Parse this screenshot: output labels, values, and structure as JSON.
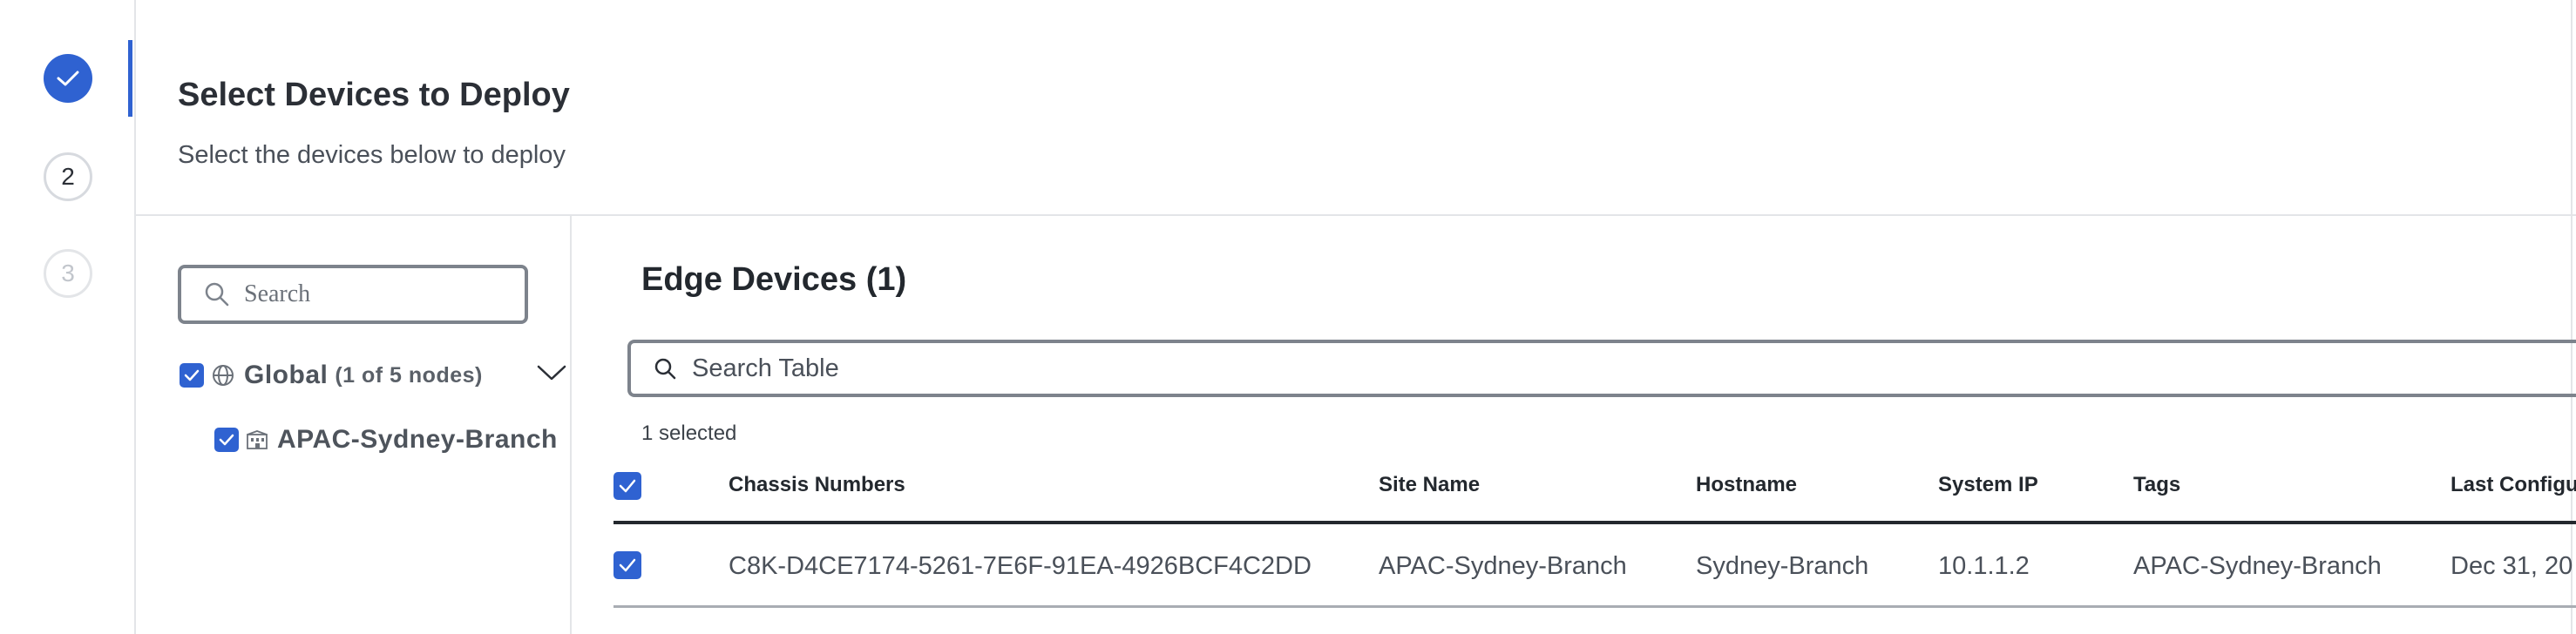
{
  "steps": [
    {
      "state": "completed",
      "label": ""
    },
    {
      "state": "current",
      "label": "2"
    },
    {
      "state": "upcoming",
      "label": "3"
    }
  ],
  "header": {
    "title": "Select Devices to Deploy",
    "subtitle": "Select the devices below to deploy"
  },
  "tree": {
    "search_placeholder": "Search",
    "root": {
      "label": "Global",
      "count": "(1 of 5 nodes)",
      "checked": true,
      "icon": "globe-icon",
      "children": [
        {
          "label": "APAC-Sydney-Branch",
          "checked": true,
          "icon": "building-icon"
        }
      ]
    }
  },
  "table": {
    "title": "Edge Devices (1)",
    "search_placeholder": "Search Table",
    "selected_text": "1 selected",
    "columns": [
      "Chassis Numbers",
      "Site Name",
      "Hostname",
      "System IP",
      "Tags",
      "Last Configu"
    ],
    "rows": [
      {
        "checked": true,
        "cells": [
          "C8K-D4CE7174-5261-7E6F-91EA-4926BCF4C2DD",
          "APAC-Sydney-Branch",
          "Sydney-Branch",
          "10.1.1.2",
          "APAC-Sydney-Branch",
          "Dec 31, 20"
        ]
      }
    ]
  },
  "colors": {
    "accent": "#2f62d1",
    "text": "#23282e",
    "muted": "#4a5059",
    "border": "#7d838c"
  }
}
